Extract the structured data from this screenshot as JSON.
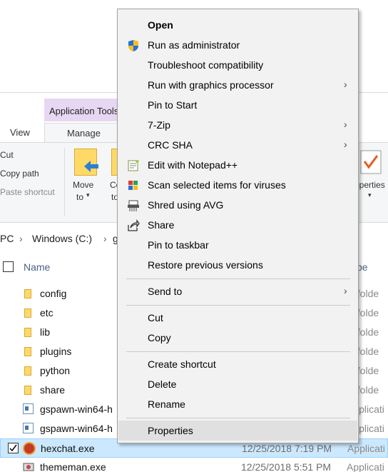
{
  "explorer": {
    "ribbon_tabs": {
      "contextual_group": "Application Tools",
      "view": "View",
      "manage": "Manage"
    },
    "clipboard": {
      "cut": "Cut",
      "copy_path": "Copy path",
      "paste_shortcut": "Paste shortcut"
    },
    "organize": {
      "move_to_line1": "Move",
      "move_to_line2": "to",
      "copy_to_partial1": "Co",
      "copy_to_partial2": "to",
      "properties_partial": "operties"
    },
    "address": {
      "pc": "PC",
      "drive": "Windows (C:)",
      "next_partial": "g"
    },
    "columns": {
      "name": "Name",
      "type_partial": "pe"
    },
    "files": [
      {
        "name": "config",
        "type": "le folde"
      },
      {
        "name": "etc",
        "type": "le folde"
      },
      {
        "name": "lib",
        "type": "le folde"
      },
      {
        "name": "plugins",
        "type": "le folde"
      },
      {
        "name": "python",
        "type": "le folde"
      },
      {
        "name": "share",
        "type": "le folde"
      },
      {
        "name": "gspawn-win64-h",
        "type": "Applicati"
      },
      {
        "name": "gspawn-win64-h",
        "type": "Applicati"
      },
      {
        "name": "hexchat.exe",
        "date": "12/25/2018 7:19 PM",
        "type": "Applicati"
      },
      {
        "name": "thememan.exe",
        "date": "12/25/2018 5:51 PM",
        "type": "Applicati"
      }
    ]
  },
  "context_menu": {
    "open": "Open",
    "run_as_admin": "Run as administrator",
    "troubleshoot": "Troubleshoot compatibility",
    "run_with_gpu": "Run with graphics processor",
    "pin_to_start": "Pin to Start",
    "seven_zip": "7-Zip",
    "crc_sha": "CRC SHA",
    "edit_notepadpp": "Edit with Notepad++",
    "scan_viruses": "Scan selected items for viruses",
    "shred_avg": "Shred using AVG",
    "share": "Share",
    "pin_taskbar": "Pin to taskbar",
    "restore_versions": "Restore previous versions",
    "send_to": "Send to",
    "cut": "Cut",
    "copy": "Copy",
    "create_shortcut": "Create shortcut",
    "delete": "Delete",
    "rename": "Rename",
    "properties": "Properties",
    "submenu_arrow": "›"
  }
}
